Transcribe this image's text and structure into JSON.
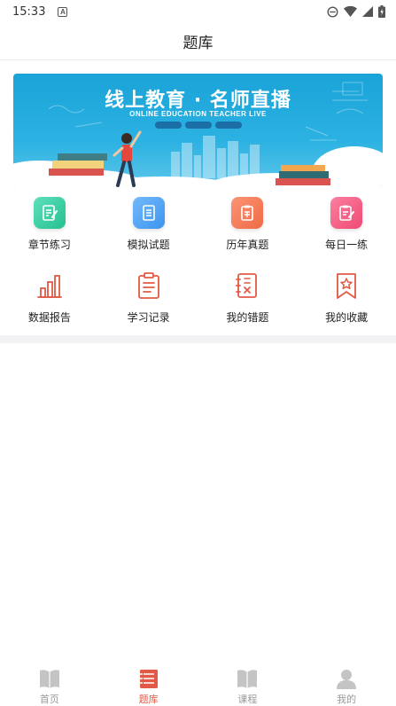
{
  "status_bar": {
    "time": "15:33",
    "notification_icon": "A"
  },
  "header": {
    "title": "题库"
  },
  "banner": {
    "title": "线上教育 · 名师直播",
    "subtitle": "ONLINE EDUCATION TEACHER LIVE"
  },
  "grid": {
    "row1": [
      {
        "label": "章节练习",
        "icon": "chapter-practice-icon",
        "color": "#2fcfa4"
      },
      {
        "label": "模拟试题",
        "icon": "mock-exam-icon",
        "color": "#4aa3f0"
      },
      {
        "label": "历年真题",
        "icon": "past-exam-icon",
        "color": "#f27856"
      },
      {
        "label": "每日一练",
        "icon": "daily-practice-icon",
        "color": "#f2557e"
      }
    ],
    "row2": [
      {
        "label": "数据报告",
        "icon": "data-report-icon"
      },
      {
        "label": "学习记录",
        "icon": "study-record-icon"
      },
      {
        "label": "我的错题",
        "icon": "wrong-questions-icon"
      },
      {
        "label": "我的收藏",
        "icon": "favorites-icon"
      }
    ]
  },
  "bottom_nav": {
    "items": [
      {
        "label": "首页",
        "icon": "home-book-icon",
        "active": false
      },
      {
        "label": "题库",
        "icon": "question-bank-icon",
        "active": true
      },
      {
        "label": "课程",
        "icon": "course-book-icon",
        "active": false
      },
      {
        "label": "我的",
        "icon": "profile-icon",
        "active": false
      }
    ]
  },
  "colors": {
    "accent": "#e25a45",
    "inactive": "#bbbbbb",
    "banner_blue": "#1aa3d8"
  }
}
